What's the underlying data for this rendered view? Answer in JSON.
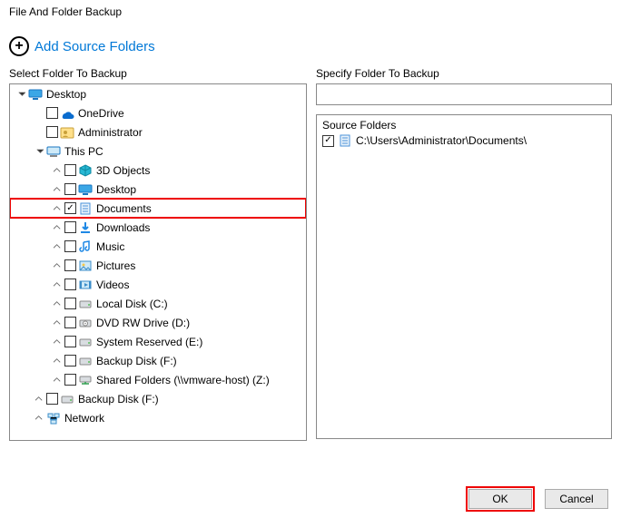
{
  "title": "File And Folder Backup",
  "add_label": "Add Source Folders",
  "left_label": "Select Folder To Backup",
  "right_label": "Specify Folder To Backup",
  "source_header": "Source Folders",
  "source_items": [
    {
      "path": "C:\\Users\\Administrator\\Documents\\",
      "checked": true
    }
  ],
  "buttons": {
    "ok": "OK",
    "cancel": "Cancel"
  },
  "tree": [
    {
      "depth": 0,
      "expander": "open",
      "checkbox": false,
      "icon": "desktop",
      "label": "Desktop",
      "highlight": false
    },
    {
      "depth": 1,
      "expander": "none",
      "checkbox": true,
      "checked": false,
      "icon": "onedrive",
      "label": "OneDrive",
      "highlight": false
    },
    {
      "depth": 1,
      "expander": "none",
      "checkbox": true,
      "checked": false,
      "icon": "user",
      "label": "Administrator",
      "highlight": false
    },
    {
      "depth": 1,
      "expander": "open",
      "checkbox": false,
      "icon": "pc",
      "label": "This PC",
      "highlight": false
    },
    {
      "depth": 2,
      "expander": "closed",
      "checkbox": true,
      "checked": false,
      "icon": "3dobjects",
      "label": "3D Objects",
      "highlight": false
    },
    {
      "depth": 2,
      "expander": "closed",
      "checkbox": true,
      "checked": false,
      "icon": "desktop-sm",
      "label": "Desktop",
      "highlight": false
    },
    {
      "depth": 2,
      "expander": "closed",
      "checkbox": true,
      "checked": true,
      "icon": "documents",
      "label": "Documents",
      "highlight": true
    },
    {
      "depth": 2,
      "expander": "closed",
      "checkbox": true,
      "checked": false,
      "icon": "downloads",
      "label": "Downloads",
      "highlight": false
    },
    {
      "depth": 2,
      "expander": "closed",
      "checkbox": true,
      "checked": false,
      "icon": "music",
      "label": "Music",
      "highlight": false
    },
    {
      "depth": 2,
      "expander": "closed",
      "checkbox": true,
      "checked": false,
      "icon": "pictures",
      "label": "Pictures",
      "highlight": false
    },
    {
      "depth": 2,
      "expander": "closed",
      "checkbox": true,
      "checked": false,
      "icon": "videos",
      "label": "Videos",
      "highlight": false
    },
    {
      "depth": 2,
      "expander": "closed",
      "checkbox": true,
      "checked": false,
      "icon": "disk",
      "label": "Local Disk (C:)",
      "highlight": false
    },
    {
      "depth": 2,
      "expander": "closed",
      "checkbox": true,
      "checked": false,
      "icon": "dvd",
      "label": "DVD RW Drive (D:)",
      "highlight": false
    },
    {
      "depth": 2,
      "expander": "closed",
      "checkbox": true,
      "checked": false,
      "icon": "disk",
      "label": "System Reserved (E:)",
      "highlight": false
    },
    {
      "depth": 2,
      "expander": "closed",
      "checkbox": true,
      "checked": false,
      "icon": "disk",
      "label": "Backup Disk (F:)",
      "highlight": false
    },
    {
      "depth": 2,
      "expander": "closed",
      "checkbox": true,
      "checked": false,
      "icon": "netdrive",
      "label": "Shared Folders (\\\\vmware-host) (Z:)",
      "highlight": false
    },
    {
      "depth": 1,
      "expander": "closed",
      "checkbox": true,
      "checked": false,
      "icon": "disk",
      "label": "Backup Disk (F:)",
      "highlight": false
    },
    {
      "depth": 1,
      "expander": "closed",
      "checkbox": false,
      "icon": "network",
      "label": "Network",
      "highlight": false
    }
  ]
}
